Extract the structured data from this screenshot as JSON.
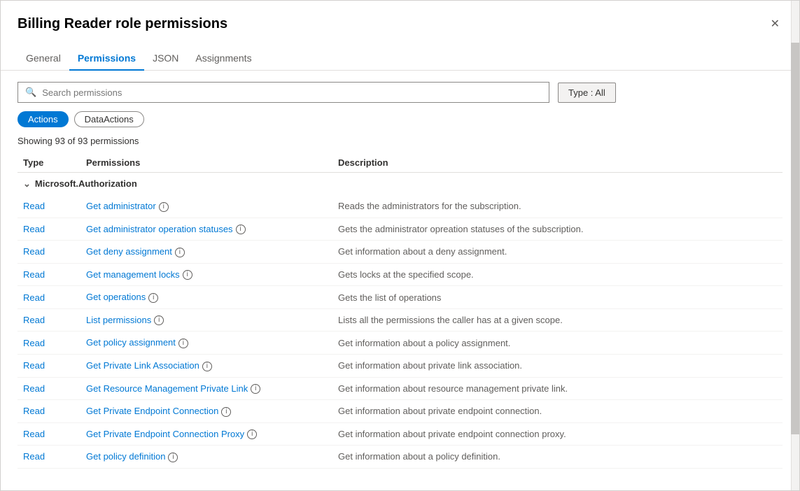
{
  "dialog": {
    "title": "Billing Reader role permissions",
    "close_label": "✕"
  },
  "tabs": [
    {
      "id": "general",
      "label": "General",
      "active": false
    },
    {
      "id": "permissions",
      "label": "Permissions",
      "active": true
    },
    {
      "id": "json",
      "label": "JSON",
      "active": false
    },
    {
      "id": "assignments",
      "label": "Assignments",
      "active": false
    }
  ],
  "search": {
    "placeholder": "Search permissions"
  },
  "type_button": {
    "label": "Type : All"
  },
  "filters": [
    {
      "id": "actions",
      "label": "Actions",
      "active": true
    },
    {
      "id": "dataactions",
      "label": "DataActions",
      "active": false
    }
  ],
  "showing_text": "Showing 93 of 93 permissions",
  "table_headers": {
    "type": "Type",
    "permissions": "Permissions",
    "description": "Description"
  },
  "group": {
    "name": "Microsoft.Authorization"
  },
  "rows": [
    {
      "type": "Read",
      "permission": "Get administrator",
      "description": "Reads the administrators for the subscription."
    },
    {
      "type": "Read",
      "permission": "Get administrator operation statuses",
      "description": "Gets the administrator opreation statuses of the subscription."
    },
    {
      "type": "Read",
      "permission": "Get deny assignment",
      "description": "Get information about a deny assignment."
    },
    {
      "type": "Read",
      "permission": "Get management locks",
      "description": "Gets locks at the specified scope."
    },
    {
      "type": "Read",
      "permission": "Get operations",
      "description": "Gets the list of operations"
    },
    {
      "type": "Read",
      "permission": "List permissions",
      "description": "Lists all the permissions the caller has at a given scope."
    },
    {
      "type": "Read",
      "permission": "Get policy assignment",
      "description": "Get information about a policy assignment."
    },
    {
      "type": "Read",
      "permission": "Get Private Link Association",
      "description": "Get information about private link association."
    },
    {
      "type": "Read",
      "permission": "Get Resource Management Private Link",
      "description": "Get information about resource management private link."
    },
    {
      "type": "Read",
      "permission": "Get Private Endpoint Connection",
      "description": "Get information about private endpoint connection."
    },
    {
      "type": "Read",
      "permission": "Get Private Endpoint Connection Proxy",
      "description": "Get information about private endpoint connection proxy."
    },
    {
      "type": "Read",
      "permission": "Get policy definition",
      "description": "Get information about a policy definition."
    }
  ]
}
